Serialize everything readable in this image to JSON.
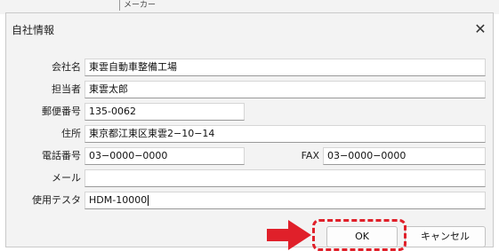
{
  "background": {
    "peek_text": "メーカー"
  },
  "dialog": {
    "title": "自社情報",
    "close_glyph": "✕",
    "fields": {
      "company_name": {
        "label": "会社名",
        "value": "東雲自動車整備工場"
      },
      "contact_person": {
        "label": "担当者",
        "value": "東雲太郎"
      },
      "postal_code": {
        "label": "郵便番号",
        "value": "135-0062"
      },
      "address": {
        "label": "住所",
        "value": "東京都江東区東雲2−10−14"
      },
      "phone": {
        "label": "電話番号",
        "value": "03−0000−0000"
      },
      "fax": {
        "label": "FAX",
        "value": "03−0000−0000"
      },
      "email": {
        "label": "メール",
        "value": ""
      },
      "tester": {
        "label": "使用テスタ",
        "value": "HDM-10000"
      }
    },
    "buttons": {
      "ok": "OK",
      "cancel": "キャンセル"
    }
  },
  "colors": {
    "highlight": "#e0202a",
    "dialog_bg": "#f3f3f3"
  }
}
